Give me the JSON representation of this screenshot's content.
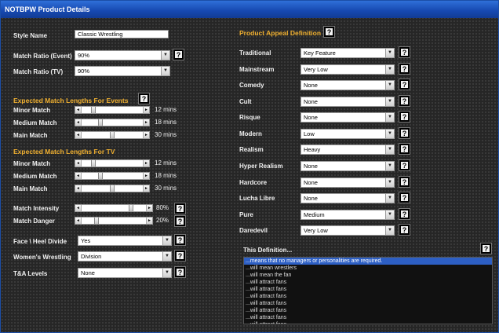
{
  "window": {
    "title": "NOTBPW Product Details"
  },
  "style_name": {
    "label": "Style Name",
    "value": "Classic Wrestling"
  },
  "match_ratio_event": {
    "label": "Match Ratio (Event)",
    "value": "90%"
  },
  "match_ratio_tv": {
    "label": "Match Ratio (TV)",
    "value": "90%"
  },
  "help_glyph": "?",
  "arrow_left": "◄",
  "arrow_right": "►",
  "arrow_down": "▼",
  "events": {
    "heading": "Expected Match Lengths For Events",
    "rows": [
      {
        "label": "Minor Match",
        "value": "12 mins",
        "level": 0.15
      },
      {
        "label": "Medium Match",
        "value": "18 mins",
        "level": 0.28
      },
      {
        "label": "Main Match",
        "value": "30 mins",
        "level": 0.5
      }
    ]
  },
  "tv": {
    "heading": "Expected Match Lengths For TV",
    "rows": [
      {
        "label": "Minor Match",
        "value": "12 mins",
        "level": 0.15
      },
      {
        "label": "Medium Match",
        "value": "18 mins",
        "level": 0.28
      },
      {
        "label": "Main Match",
        "value": "30 mins",
        "level": 0.5
      }
    ]
  },
  "intensity": {
    "label": "Match Intensity",
    "value": "80%",
    "level": 0.8
  },
  "danger": {
    "label": "Match Danger",
    "value": "20%",
    "level": 0.2
  },
  "face_heel": {
    "label": "Face \\ Heel Divide",
    "value": "Yes"
  },
  "womens": {
    "label": "Women's Wrestling",
    "value": "Division"
  },
  "ta": {
    "label": "T&A Levels",
    "value": "None"
  },
  "appeal": {
    "heading": "Product Appeal Definition",
    "rows": [
      {
        "label": "Traditional",
        "value": "Key Feature"
      },
      {
        "label": "Mainstream",
        "value": "Very Low"
      },
      {
        "label": "Comedy",
        "value": "None"
      },
      {
        "label": "Cult",
        "value": "None"
      },
      {
        "label": "Risque",
        "value": "None"
      },
      {
        "label": "Modern",
        "value": "Low"
      },
      {
        "label": "Realism",
        "value": "Heavy"
      },
      {
        "label": "Hyper Realism",
        "value": "None"
      },
      {
        "label": "Hardcore",
        "value": "None"
      },
      {
        "label": "Lucha Libre",
        "value": "None"
      },
      {
        "label": "Pure",
        "value": "Medium"
      },
      {
        "label": "Daredevil",
        "value": "Very Low"
      }
    ]
  },
  "definition": {
    "label": "This Definition...",
    "items": [
      "...means that no managers or personalities are required.",
      "...will mean wrestlers",
      "...will mean the fan",
      "...will attract fans",
      "...will attract fans",
      "...will attract fans",
      "...will attract fans",
      "...will attract fans",
      "...will attract fans",
      "...will attract fans"
    ]
  }
}
